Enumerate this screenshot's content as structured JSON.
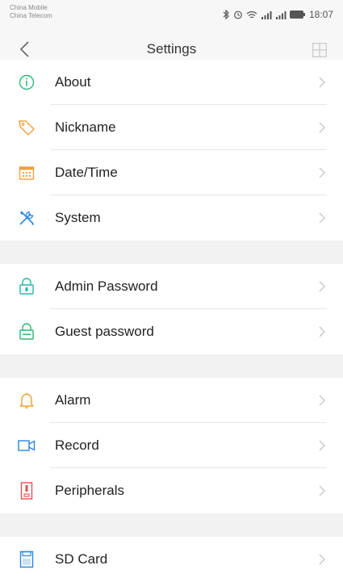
{
  "status_bar": {
    "carrier_1": "China Mobile",
    "carrier_2": "China Telecom",
    "time": "18:07"
  },
  "header": {
    "title": "Settings"
  },
  "colors": {
    "info_green": "#2eb872",
    "orange": "#f2a03d",
    "blue": "#2b87d9",
    "teal": "#28b6a6",
    "red": "#e25050",
    "chevron": "#c8c8c8"
  },
  "settings_groups": [
    {
      "items": [
        {
          "icon": "info-icon",
          "label": "About"
        },
        {
          "icon": "tag-icon",
          "label": "Nickname"
        },
        {
          "icon": "calendar-icon",
          "label": "Date/Time"
        },
        {
          "icon": "tools-icon",
          "label": "System"
        }
      ]
    },
    {
      "items": [
        {
          "icon": "lock-icon",
          "label": "Admin Password"
        },
        {
          "icon": "lock-icon",
          "label": "Guest password"
        }
      ]
    },
    {
      "items": [
        {
          "icon": "bell-icon",
          "label": "Alarm"
        },
        {
          "icon": "video-camera-icon",
          "label": "Record"
        },
        {
          "icon": "device-icon",
          "label": "Peripherals"
        }
      ]
    },
    {
      "items": [
        {
          "icon": "sd-card-icon",
          "label": "SD Card"
        }
      ]
    }
  ]
}
